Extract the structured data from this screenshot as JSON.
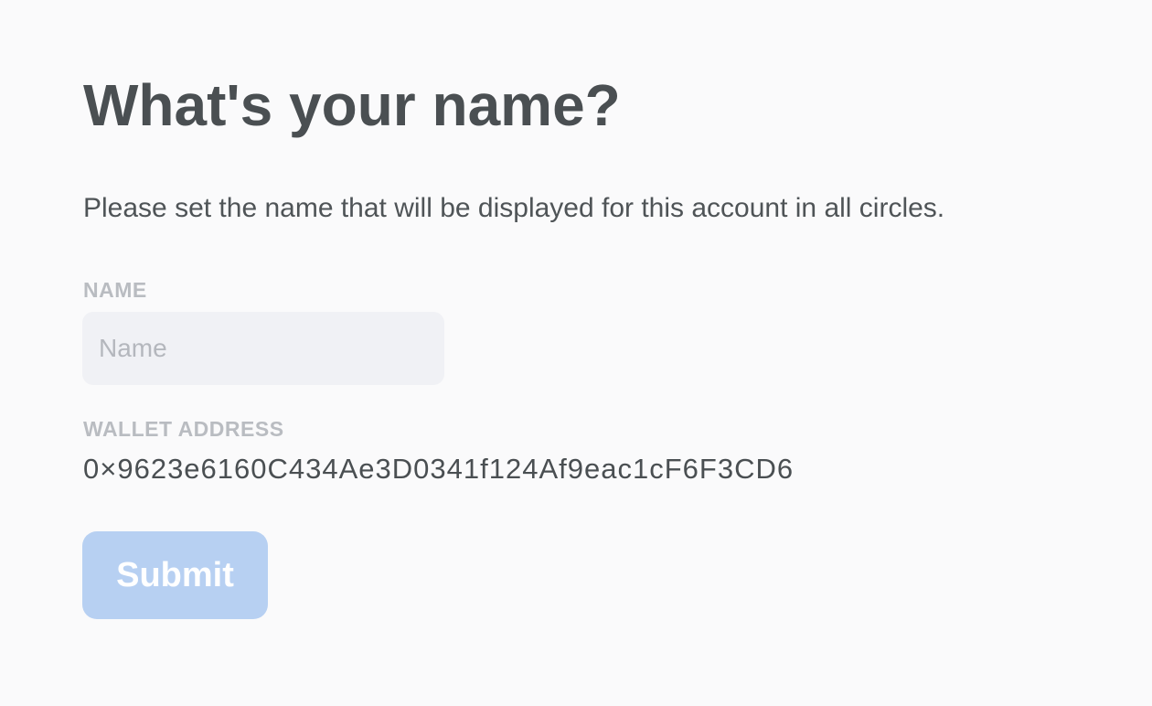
{
  "form": {
    "title": "What's your name?",
    "description": "Please set the name that will be displayed for this account in all circles.",
    "name_label": "NAME",
    "name_value": "",
    "name_placeholder": "Name",
    "wallet_label": "WALLET ADDRESS",
    "wallet_address": "0×9623e6160C434Ae3D0341f124Af9eac1cF6F3CD6",
    "submit_label": "Submit"
  },
  "colors": {
    "background": "#fafafb",
    "heading": "#4a4f52",
    "label": "#b9bcc1",
    "input_background": "#f0f1f5",
    "button_disabled": "#b7d0f2"
  }
}
